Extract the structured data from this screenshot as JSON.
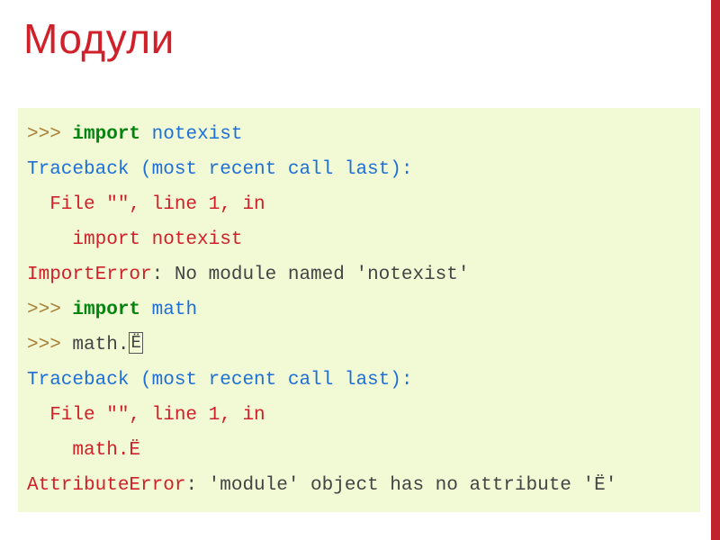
{
  "title": "Модули",
  "code": {
    "l1_prompt": ">>> ",
    "l1_kw": "import",
    "l1_sp": " ",
    "l1_mod": "notexist",
    "l2": "Traceback (most recent call last):",
    "l3": "  File \"\", line 1, in ",
    "l4": "    import notexist",
    "l5_err": "ImportError",
    "l5_msg": ": No module named 'notexist'",
    "l6_prompt": ">>> ",
    "l6_kw": "import",
    "l6_sp": " ",
    "l6_mod": "math",
    "l7_prompt": ">>> ",
    "l7_expr": "math.",
    "l7_char": "Ё",
    "l8": "Traceback (most recent call last):",
    "l9": "  File \"\", line 1, in ",
    "l10": "    math.Ё",
    "l11_err": "AttributeError",
    "l11_msg": ": 'module' object has no attribute 'Ё'"
  }
}
